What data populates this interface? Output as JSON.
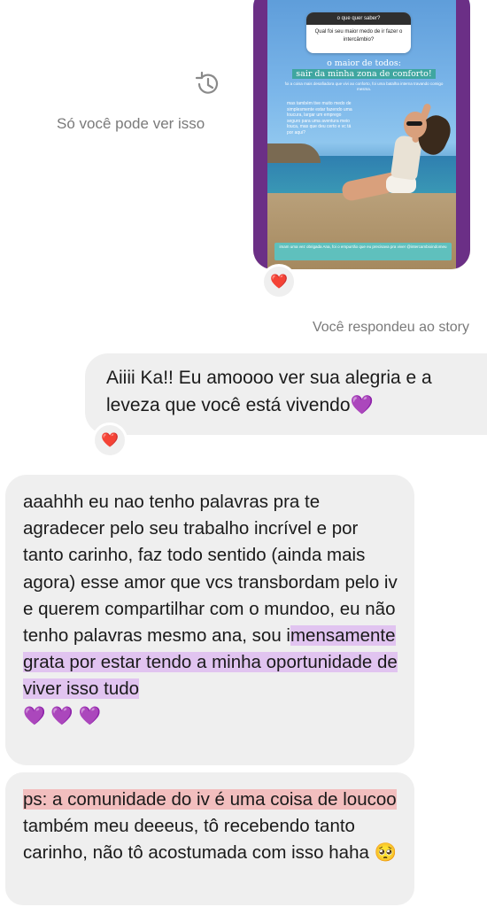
{
  "story": {
    "question_header": "o que quer saber?",
    "question_text": "Qual foi seu maior medo de ir fazer o intercâmbio?",
    "headline_1": "o maior de todos:",
    "headline_2": "sair da minha zona de conforto!",
    "small_text": "foi a coisa mais desafiadora que vivi ao conforto, foi uma batalha interna travando comigo mesma.",
    "body_text": "mas também tive muito medo de simplesmente estar fazendo uma loucura, largar um emprego seguro para uma aventura meio louca, mas que deu certo e vc tá por aqui?",
    "caption": "imam uma vez obrigada Ana, foi o empurrão que eu precisava pra viver @intercambioindomeu"
  },
  "reactions": {
    "story_reaction": "❤️",
    "message_reaction": "❤️"
  },
  "only_you_text": "Só você pode ver isso",
  "replied_text": "Você respondeu ao story",
  "outgoing_message": "Aiiii Ka!! Eu amoooo ver sua alegria e a leveza que você está vivendo💜",
  "incoming_message_1": {
    "text_plain": "aaahhh eu nao tenho palavras pra te agradecer pelo seu trabalho incrível e por tanto carinho, faz todo sentido (ainda mais agora) esse amor que vcs transbordam pelo iv e querem compartilhar com o mundoo, eu não tenho palavras mesmo ana, sou i",
    "text_highlight": "mensamente grata por estar tendo a minha oportunidade de viver isso tudo",
    "hearts": "💜 💜 💜"
  },
  "incoming_message_2": {
    "text_highlight": "ps: a comunidade do iv é uma coisa de loucoo",
    "text_plain": " também meu deeeus, tô recebendo tanto carinho, não tô acostumada com isso haha 🥺"
  },
  "icons": {
    "history": "history-clock-icon",
    "heart": "heart-icon"
  }
}
